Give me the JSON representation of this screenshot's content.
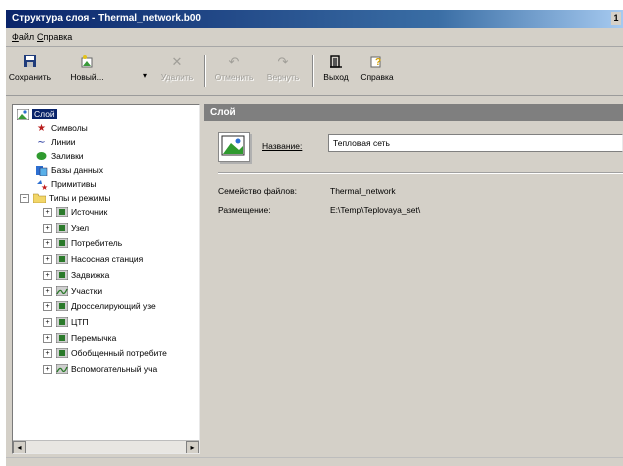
{
  "window": {
    "title": "Структура слоя - Thermal_network.b00",
    "corner_glyph": "1"
  },
  "menu": {
    "file": "Файл",
    "help": "Справка"
  },
  "toolbar": {
    "save": "Сохранить",
    "new": "Новый...",
    "delete": "Удалить",
    "undo": "Отменить",
    "redo": "Вернуть",
    "exit": "Выход",
    "help": "Справка"
  },
  "tree": {
    "root": "Слой",
    "items": [
      "Символы",
      "Линии",
      "Заливки",
      "Базы данных",
      "Примитивы"
    ],
    "types_label": "Типы и режимы",
    "types": [
      "Источник",
      "Узел",
      "Потребитель",
      "Насосная станция",
      "Задвижка",
      "Участки",
      "Дросселирующий узе",
      "ЦТП",
      "Перемычка",
      "Обобщенный потребите",
      "Вспомогательный уча"
    ]
  },
  "panel": {
    "header": "Слой",
    "name_label": "Название:",
    "name_value": "Тепловая сеть",
    "family_label": "Семейство файлов:",
    "family_value": "Thermal_network",
    "location_label": "Размещение:",
    "location_value": "E:\\Temp\\Teplovaya_set\\"
  },
  "colors": {
    "titlebar": "#0a246a",
    "selection": "#0a246a",
    "panel_header": "#7f7f7f"
  }
}
